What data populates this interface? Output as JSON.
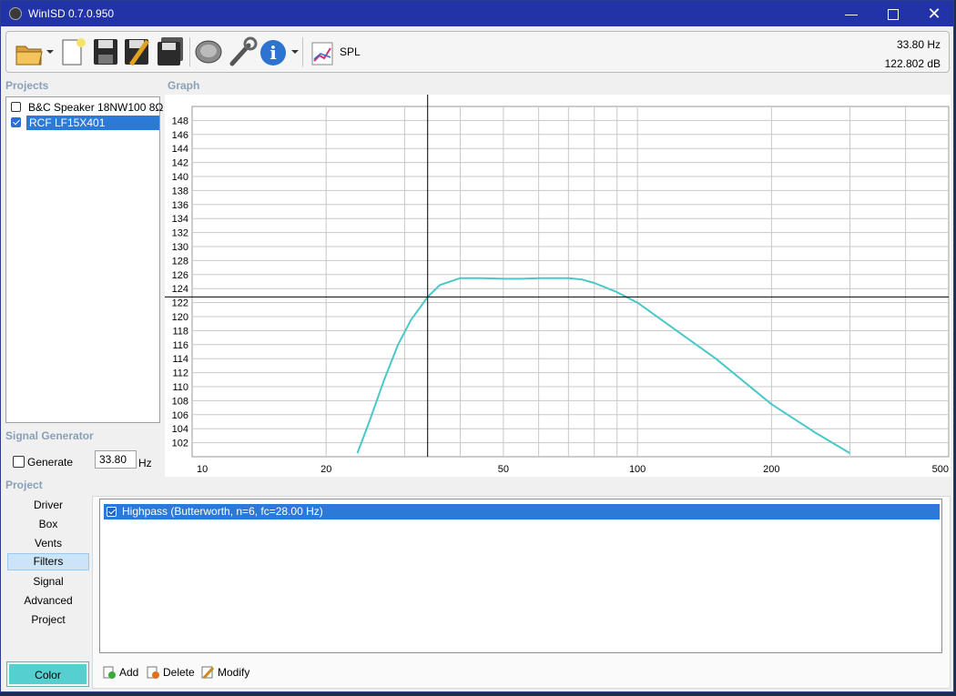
{
  "window": {
    "title": "WinISD 0.7.0.950"
  },
  "toolbar": {
    "spl_label": "SPL",
    "freq_readout": "33.80 Hz",
    "db_readout": "122.802 dB"
  },
  "sections": {
    "projects": "Projects",
    "graph": "Graph",
    "signal_generator": "Signal Generator",
    "project": "Project"
  },
  "projects": [
    {
      "label": "B&C Speaker  18NW100 8Ω",
      "checked": false,
      "selected": false
    },
    {
      "label": "RCF  LF15X401",
      "checked": true,
      "selected": true
    }
  ],
  "signal_generator": {
    "generate_label": "Generate",
    "generate_checked": false,
    "frequency_value": "33.80",
    "unit": "Hz"
  },
  "nav": [
    {
      "label": "Driver",
      "active": false
    },
    {
      "label": "Box",
      "active": false
    },
    {
      "label": "Vents",
      "active": false
    },
    {
      "label": "Filters",
      "active": true
    },
    {
      "label": "Signal",
      "active": false
    },
    {
      "label": "Advanced",
      "active": false
    },
    {
      "label": "Project",
      "active": false
    }
  ],
  "color_button": "Color",
  "filters": [
    {
      "label": "Highpass (Butterworth, n=6, fc=28.00 Hz)",
      "checked": true
    }
  ],
  "actions": {
    "add": "Add",
    "delete": "Delete",
    "modify": "Modify"
  },
  "chart_data": {
    "type": "line",
    "x_scale": "log",
    "xlim": [
      10,
      500
    ],
    "ylim": [
      100,
      150
    ],
    "x_ticks": [
      10,
      20,
      50,
      100,
      200,
      500
    ],
    "y_ticks": [
      102,
      104,
      106,
      108,
      110,
      112,
      114,
      116,
      118,
      120,
      122,
      124,
      126,
      128,
      130,
      132,
      134,
      136,
      138,
      140,
      142,
      144,
      146,
      148
    ],
    "grid": true,
    "crosshair": {
      "x": 33.8,
      "y": 122.802
    },
    "line_color": "#4ac8c8",
    "series": [
      {
        "x": [
          23.5,
          25,
          27,
          29,
          31,
          33.8,
          36,
          40,
          45,
          50,
          55,
          60,
          70,
          75,
          80,
          90,
          100,
          150,
          200,
          250,
          300
        ],
        "y": [
          100.5,
          105,
          111,
          116,
          119.5,
          122.8,
          124.5,
          125.5,
          125.5,
          125.4,
          125.4,
          125.5,
          125.5,
          125.3,
          124.8,
          123.5,
          122.0,
          114.0,
          107.5,
          103.5,
          100.5
        ]
      }
    ]
  },
  "colors": {
    "title_bar": "#2233a8",
    "selection": "#2b7ad8",
    "color_swatch": "#55cfcf",
    "nav_active": "#cce4f7",
    "section_label": "#8aa0b8"
  }
}
